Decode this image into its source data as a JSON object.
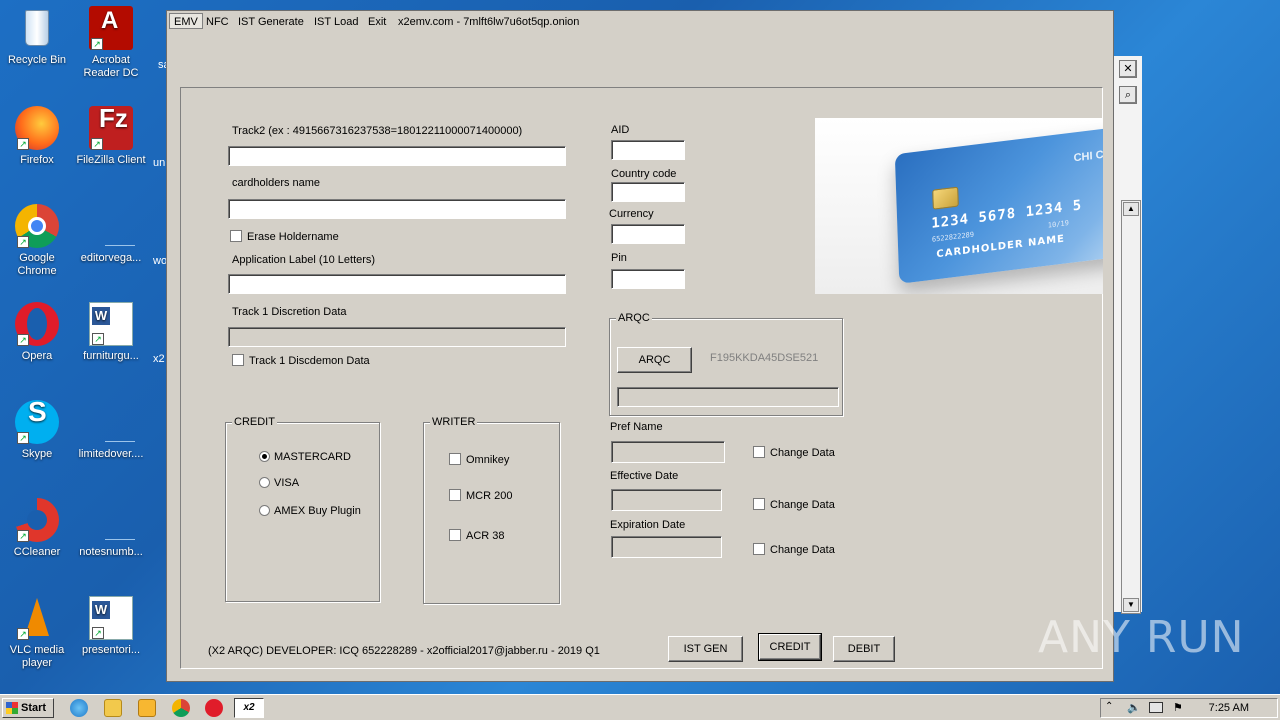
{
  "desktop": {
    "icons": [
      {
        "label": "Recycle Bin"
      },
      {
        "label": "Acrobat Reader DC"
      },
      {
        "label": "Firefox"
      },
      {
        "label": "FileZilla Client"
      },
      {
        "label": "Google Chrome"
      },
      {
        "label": "editorvega..."
      },
      {
        "label": "Opera"
      },
      {
        "label": "furniturgu..."
      },
      {
        "label": "Skype"
      },
      {
        "label": "limitedover...."
      },
      {
        "label": "CCleaner"
      },
      {
        "label": "notesnumb..."
      },
      {
        "label": "VLC media player"
      },
      {
        "label": "presentori..."
      }
    ],
    "partial_labels": [
      "sa",
      "un",
      "wo",
      "x2"
    ]
  },
  "window": {
    "menu": [
      "EMV",
      "NFC",
      "IST Generate",
      "IST Load",
      "Exit",
      "x2emv.com - 7mlft6lw7u6ot5qp.onion"
    ],
    "track2_label": "Track2 (ex : 4915667316237538=18012211000071400000)",
    "track2_value": "",
    "cardholders_label": "cardholders name",
    "cardholders_value": "",
    "erase_holdername": "Erase Holdername",
    "app_label_label": "Application Label (10 Letters)",
    "app_label_value": "",
    "track1_label": "Track 1 Discretion Data",
    "track1_check": "Track 1 Discdemon Data",
    "aid_label": "AID",
    "country_label": "Country code",
    "currency_label": "Currency",
    "pin_label": "Pin",
    "arqc_group": "ARQC",
    "arqc_button": "ARQC",
    "arqc_value": "F195KKDA45DSE521",
    "credit_group": "CREDIT",
    "credit_options": [
      "MASTERCARD",
      "VISA",
      "AMEX Buy Plugin"
    ],
    "credit_selected": "MASTERCARD",
    "writer_group": "WRITER",
    "writer_options": [
      "Omnikey",
      "MCR 200",
      "ACR 38"
    ],
    "pref_name_label": "Pref Name",
    "effective_date_label": "Effective Date",
    "expiration_date_label": "Expiration Date",
    "change_data": "Change Data",
    "footer": "(X2 ARQC) DEVELOPER: ICQ 652228289 - x2official2017@jabber.ru - 2019 Q1",
    "buttons": {
      "ist_gen": "IST GEN",
      "credit": "CREDIT",
      "debit": "DEBIT"
    },
    "card_image": {
      "number": "1234 5678 1234 5",
      "small_number": "6522822289",
      "name": "CARDHOLDER NAME",
      "corner": "CHI CA",
      "expiry": "10/19"
    }
  },
  "taskbar": {
    "start": "Start",
    "active_app": "x2",
    "time": "7:25 AM"
  },
  "watermark": "ANY RUN",
  "colors": {
    "desktop": "#1d6fc4",
    "window_face": "#d4d0c8",
    "card": "#2a6fc0"
  }
}
